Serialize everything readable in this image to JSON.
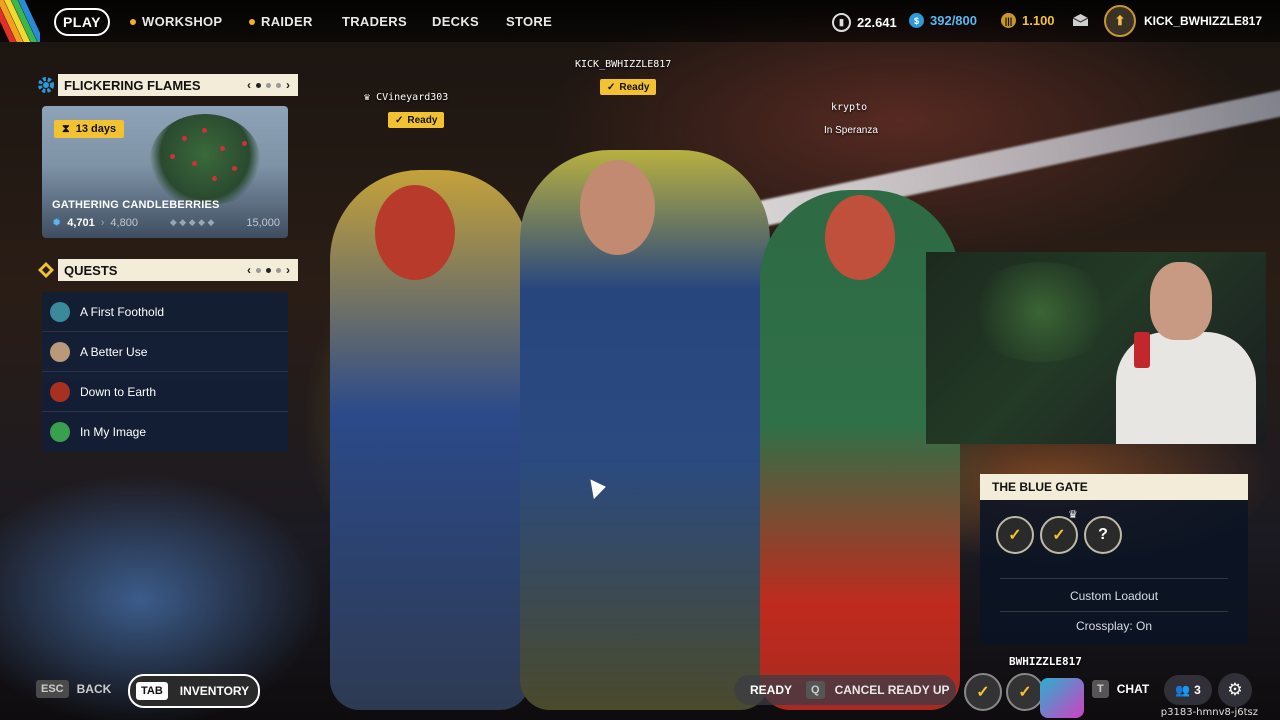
{
  "nav": {
    "play": "PLAY",
    "items": [
      {
        "label": "WORKSHOP",
        "has_dot": true
      },
      {
        "label": "RAIDER",
        "has_dot": true
      },
      {
        "label": "TRADERS",
        "has_dot": false
      },
      {
        "label": "DECKS",
        "has_dot": false
      },
      {
        "label": "STORE",
        "has_dot": false
      }
    ]
  },
  "currency": {
    "coins": "22.641",
    "tokens": "392/800",
    "credits": "1.100"
  },
  "profile": {
    "name": "KICK_BWHIZZLE817"
  },
  "event_panel": {
    "title": "FLICKERING FLAMES",
    "timer": "13 days",
    "event_name": "GATHERING CANDLEBERRIES",
    "progress_current": "4,701",
    "progress_next": "4,800",
    "progress_max": "15,000"
  },
  "quests_panel": {
    "title": "QUESTS",
    "items": [
      {
        "label": "A First Foothold",
        "icon_color": "#3a8a9a"
      },
      {
        "label": "A Better Use",
        "icon_color": "#b89a7a"
      },
      {
        "label": "Down to Earth",
        "icon_color": "#a83020"
      },
      {
        "label": "In My Image",
        "icon_color": "#3aa050"
      }
    ]
  },
  "squad": {
    "player_left": {
      "name": "CVineyard303",
      "status": "Ready"
    },
    "player_center": {
      "name": "KICK_BWHIZZLE817",
      "status": "Ready"
    },
    "player_right": {
      "name": "krypto",
      "status": "In Speranza"
    }
  },
  "mission": {
    "title": "THE BLUE GATE",
    "loadout": "Custom Loadout",
    "crossplay": "Crossplay: On",
    "slot_unknown": "?"
  },
  "bottom": {
    "esc_key": "ESC",
    "back_label": "BACK",
    "tab_key": "TAB",
    "inventory_label": "INVENTORY",
    "ready_label": "READY",
    "cancel_key": "Q",
    "cancel_label": "CANCEL READY UP",
    "player_name": "BWHIZZLE817",
    "chat_key": "T",
    "chat_label": "CHAT",
    "party_count": "3",
    "session_id": "p3183-hmnv8-j6tsz"
  },
  "colors": {
    "accent_yellow": "#f2c230",
    "panel_header": "#f3ecd8",
    "panel_dark": "#121e36",
    "token_blue": "#2a9ad8"
  }
}
